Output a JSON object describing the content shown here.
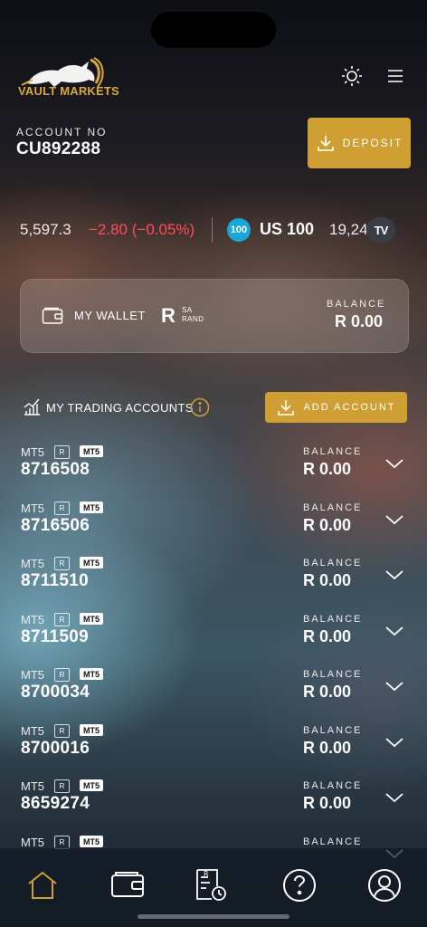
{
  "app": {
    "brand": "VAULT MARKETS"
  },
  "account": {
    "label": "ACCOUNT NO",
    "number": "CU892288"
  },
  "deposit": {
    "label": "DEPOSIT"
  },
  "ticker": {
    "value": "5,597.3",
    "change": "−2.80 (−0.05%)",
    "badge": "100",
    "symbol": "US 100",
    "price": "19,24",
    "provider_mark": "TV"
  },
  "wallet": {
    "label": "MY WALLET",
    "currency_symbol": "R",
    "currency_line1": "SA",
    "currency_line2": "RAND",
    "balance_label": "BALANCE",
    "balance": "R 0.00"
  },
  "trading": {
    "title": "MY TRADING ACCOUNTS",
    "add_label": "ADD ACCOUNT",
    "accounts": [
      {
        "platform": "MT5",
        "currency": "R",
        "tag": "MT5",
        "number": "8716508",
        "balance_label": "BALANCE",
        "balance": "R 0.00"
      },
      {
        "platform": "MT5",
        "currency": "R",
        "tag": "MT5",
        "number": "8716506",
        "balance_label": "BALANCE",
        "balance": "R 0.00"
      },
      {
        "platform": "MT5",
        "currency": "R",
        "tag": "MT5",
        "number": "8711510",
        "balance_label": "BALANCE",
        "balance": "R 0.00"
      },
      {
        "platform": "MT5",
        "currency": "R",
        "tag": "MT5",
        "number": "8711509",
        "balance_label": "BALANCE",
        "balance": "R 0.00"
      },
      {
        "platform": "MT5",
        "currency": "R",
        "tag": "MT5",
        "number": "8700034",
        "balance_label": "BALANCE",
        "balance": "R 0.00"
      },
      {
        "platform": "MT5",
        "currency": "R",
        "tag": "MT5",
        "number": "8700016",
        "balance_label": "BALANCE",
        "balance": "R 0.00"
      },
      {
        "platform": "MT5",
        "currency": "R",
        "tag": "MT5",
        "number": "8659274",
        "balance_label": "BALANCE",
        "balance": "R 0.00"
      },
      {
        "platform": "MT5",
        "currency": "R",
        "tag": "MT5",
        "number": "",
        "balance_label": "BALANCE",
        "balance": ""
      }
    ]
  },
  "nav": {
    "items": [
      {
        "icon": "home-icon",
        "active": true
      },
      {
        "icon": "wallet-icon",
        "active": false
      },
      {
        "icon": "history-icon",
        "active": false
      },
      {
        "icon": "help-icon",
        "active": false
      },
      {
        "icon": "profile-icon",
        "active": false
      }
    ]
  },
  "colors": {
    "accent": "#cf9f33",
    "negative": "#ff4d5a",
    "ticker_badge": "#1aa6d6"
  }
}
